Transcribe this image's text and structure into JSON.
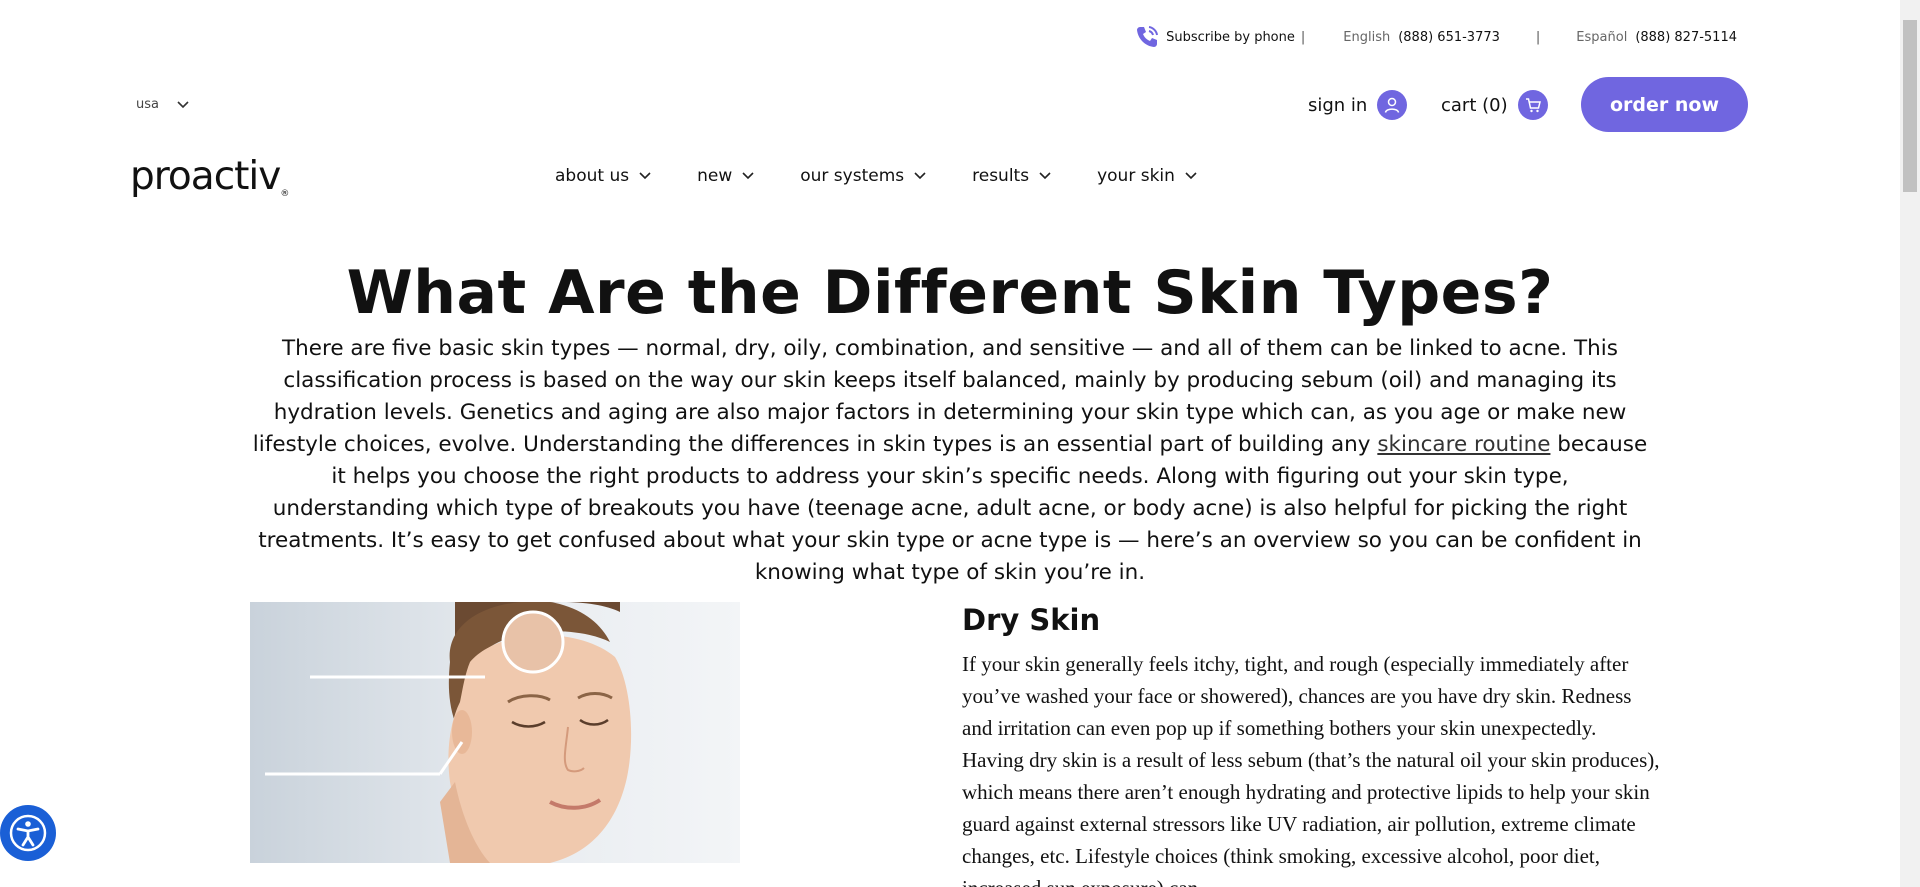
{
  "utility": {
    "subscribe_label": "Subscribe by phone",
    "separator": "|",
    "english_label": "English",
    "english_phone": "(888) 651-3773",
    "pipe": "|",
    "spanish_label": "Español",
    "spanish_phone": "(888) 827-5114"
  },
  "header": {
    "country": "usa",
    "signin_label": "sign in",
    "cart_label": "cart (0)",
    "order_label": "order now",
    "logo": "proactiv",
    "logo_mark": "®"
  },
  "nav": {
    "items": [
      {
        "label": "about us"
      },
      {
        "label": "new"
      },
      {
        "label": "our systems"
      },
      {
        "label": "results"
      },
      {
        "label": "your skin"
      }
    ]
  },
  "main": {
    "title": "What Are the Different Skin Types?",
    "intro_before": "There are five basic skin types — normal, dry, oily, combination, and sensitive — and all of them can be linked to acne. This classification process is based on the way our skin keeps itself balanced, mainly by producing sebum (oil) and managing its hydration levels. Genetics and aging are also major factors in determining your skin type which can, as you age or make new lifestyle choices, evolve. Understanding the differences in skin types is an essential part of building any ",
    "intro_link": "skincare routine",
    "intro_after": " because it helps you choose the right products to address your skin’s specific needs. Along with figuring out your skin type, understanding which type of breakouts you have (teenage acne, adult acne, or body acne) is also helpful for picking the right treatments. It’s easy to get confused about what your skin type or acne type is — here’s an overview so you can be confident in knowing what type of skin you’re in.",
    "section": {
      "title": "Dry Skin",
      "body": "If your skin generally feels itchy, tight, and rough (especially immediately after you’ve washed your face or showered), chances are you have dry skin. Redness and irritation can even pop up if something bothers your skin unexpectedly. Having dry skin is a result of less sebum (that’s the natural oil your skin produces), which means there aren’t enough hydrating and protective lipids to help your skin guard against external stressors like UV radiation, air pollution, extreme climate changes, etc. Lifestyle choices (think smoking, excessive alcohol, poor diet, increased sun exposure) can"
    }
  },
  "colors": {
    "accent": "#7066e0",
    "a11y": "#1a5fd6"
  },
  "icons": [
    "phone-icon",
    "chevron-down-icon",
    "user-icon",
    "cart-icon",
    "accessibility-icon"
  ]
}
